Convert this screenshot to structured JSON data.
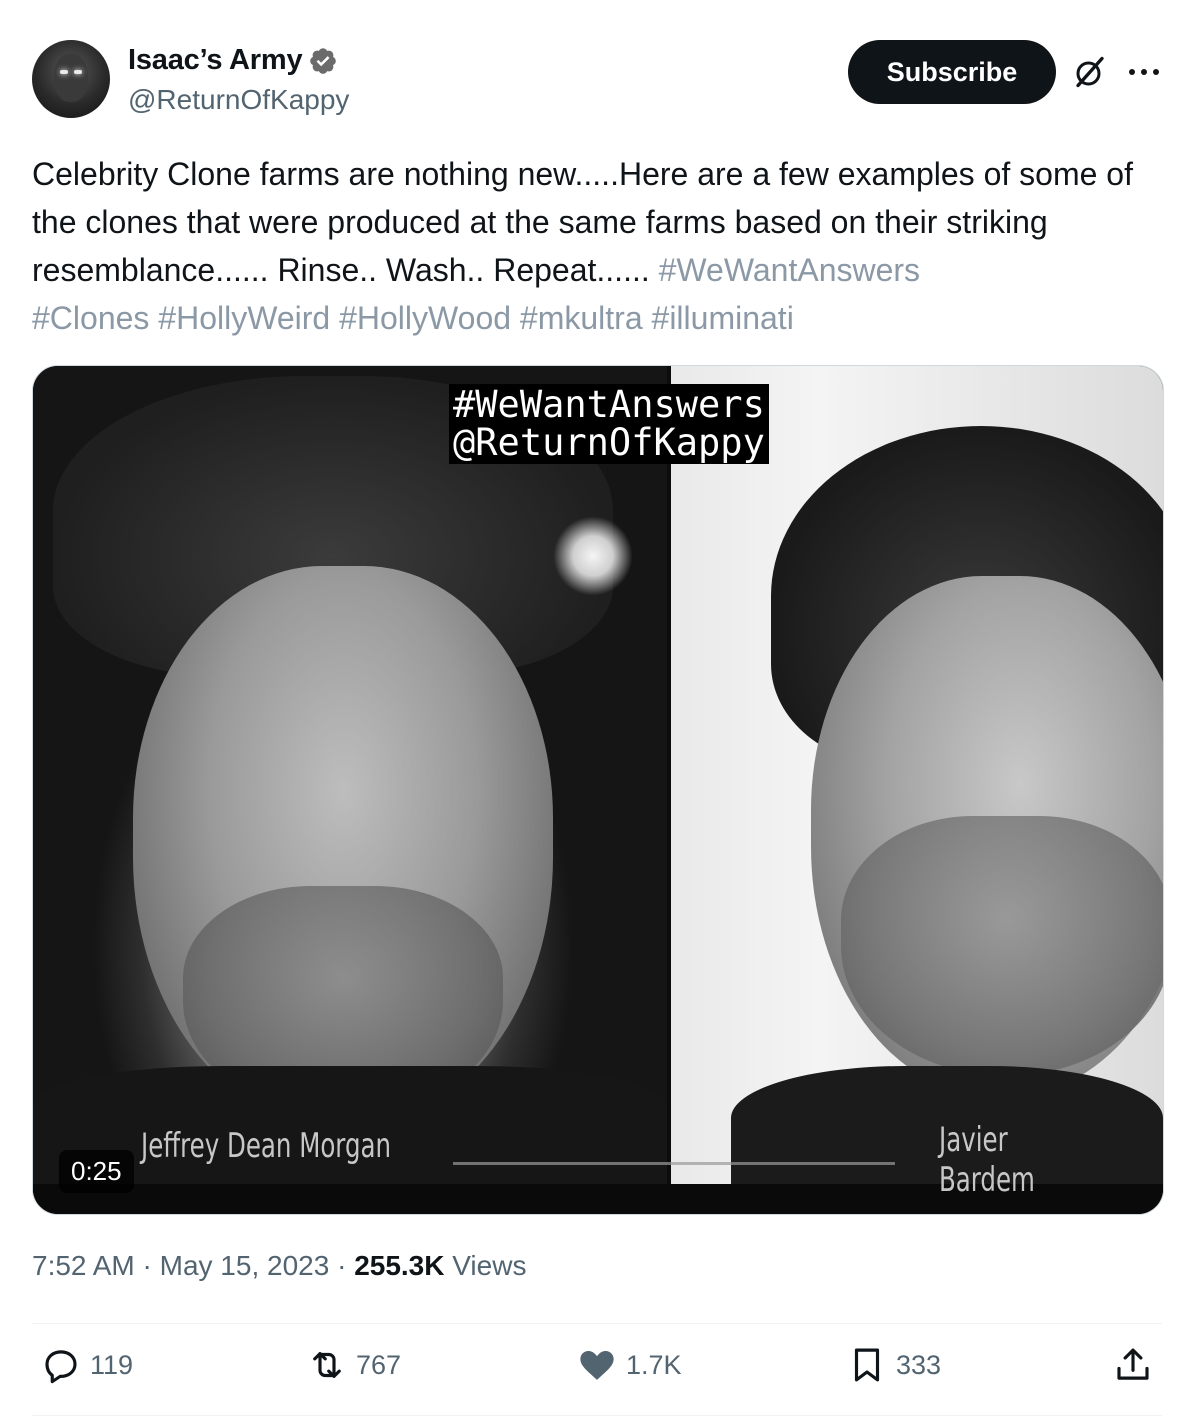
{
  "author": {
    "display_name": "Isaac’s Army",
    "handle": "@ReturnOfKappy"
  },
  "header": {
    "subscribe_label": "Subscribe"
  },
  "tweet": {
    "text_parts": [
      "Celebrity Clone farms are nothing new.....Here are a few examples of some of the clones that were produced at the same farms  based on their striking resemblance...... Rinse.. Wash.. Repeat...... "
    ],
    "hashtags": [
      "#WeWantAnswers",
      "#Clones",
      "#HollyWeird",
      "#HollyWood",
      "#mkultra",
      "#illuminati"
    ]
  },
  "media": {
    "watermark_line1": "#WeWantAnswers",
    "watermark_line2": "@ReturnOfKappy",
    "caption_left": "Jeffrey Dean Morgan",
    "caption_right": "Javier Bardem",
    "duration": "0:25"
  },
  "meta": {
    "time": "7:52 AM",
    "dot1": " · ",
    "date": "May 15, 2023",
    "dot2": " · ",
    "views_count": "255.3K",
    "views_label": " Views"
  },
  "actions": {
    "replies": "119",
    "reposts": "767",
    "likes": "1.7K",
    "bookmarks": "333"
  },
  "colors": {
    "text": "#0f1419",
    "secondary": "#536471",
    "hashtag": "#8b98a5",
    "verified": "#6b6b6b"
  }
}
